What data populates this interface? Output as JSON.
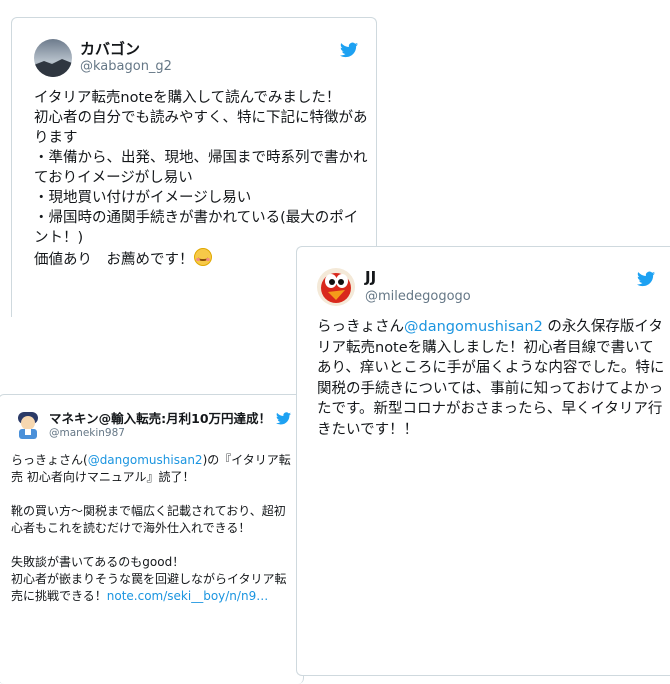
{
  "colors": {
    "link": "#1b95e0",
    "twitter_blue": "#1da1f2",
    "handle_gray": "#657786",
    "border": "#cfd9de"
  },
  "tweets": [
    {
      "name": "カバゴン",
      "handle": "@kabagon_g2",
      "avatar_icon": "avatar-landscape",
      "body": "イタリア転売noteを購入して読んでみました！\n初心者の自分でも読みやすく、特に下記に特徴があります\n・準備から、出発、現地、帰国まで時系列で書かれておりイメージがし易い\n・現地買い付けがイメージし易い\n・帰国時の通関手続きが書かれている(最大のポイント！)\n価値あり　お薦めです！",
      "emoji": "smiling-face-icon"
    },
    {
      "name": "JJ",
      "handle": "@miledegogogo",
      "avatar_icon": "avatar-red-bird",
      "body_pre": "らっきょさん",
      "mention": "@dangomushisan2",
      "body_post": " の永久保存版イタリア転売noteを購入しました！初心者目線で書いてあり、痒いところに手が届くような内容でした。特に関税の手続きについては、事前に知っておけてよかったです。新型コロナがおさまったら、早くイタリア行きたいです！！"
    },
    {
      "name": "マネキン@輸入転売:月利10万円達成！",
      "handle": "@manekin987",
      "avatar_icon": "avatar-mannequin",
      "body_pre": "らっきょさん(",
      "mention": "@dangomushisan2",
      "body_mid": ")の『イタリア転売 初心者向けマニュアル』読了！\n\n靴の買い方〜関税まで幅広く記載されており、超初心者もこれを読むだけで海外仕入れできる！\n\n失敗談が書いてあるのもgood！\n初心者が嵌まりそうな罠を回避しながらイタリア転売に挑戦できる！",
      "link": "note.com/seki__boy/n/n9…"
    }
  ]
}
